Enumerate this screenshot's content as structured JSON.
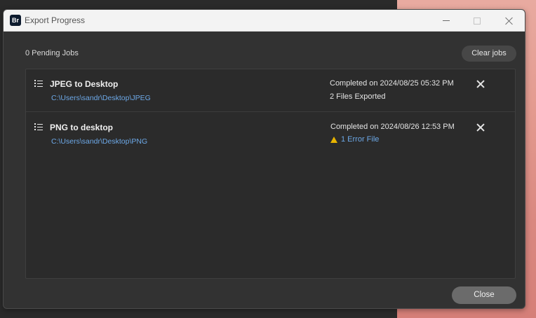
{
  "window": {
    "app_icon": "Br",
    "title": "Export Progress",
    "controls": [
      "minimize-icon",
      "maximize-icon",
      "close-icon"
    ]
  },
  "header": {
    "pending_label": "0 Pending Jobs",
    "clear_label": "Clear jobs"
  },
  "jobs": [
    {
      "name": "JPEG to Desktop",
      "path": "C:\\Users\\sandr\\Desktop\\JPEG",
      "status": "Completed on 2024/08/25 05:32 PM",
      "detail": "2 Files Exported",
      "icon": "list-icon",
      "remove_icon": "close-icon"
    },
    {
      "name": "PNG to desktop",
      "path": "C:\\Users\\sandr\\Desktop\\PNG",
      "status": "Completed on 2024/08/26 12:53 PM",
      "detail": "1 Error File",
      "detail_icon": "warning-icon",
      "icon": "list-icon",
      "remove_icon": "close-icon"
    }
  ],
  "footer": {
    "close_label": "Close"
  },
  "colors": {
    "link": "#6da9e8",
    "warning": "#e8b400",
    "window_bg": "#323232",
    "titlebar_bg": "#f3f3f3"
  }
}
